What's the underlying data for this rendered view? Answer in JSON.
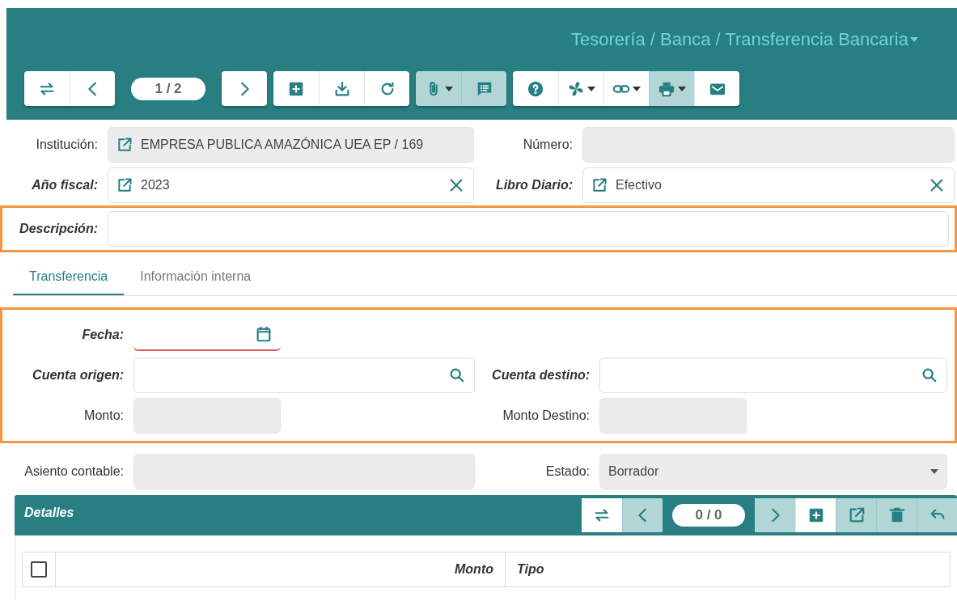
{
  "header": {
    "breadcrumb": "Tesorería / Banca / Transferencia Bancaria",
    "breadcrumb_dropdown": true
  },
  "toolbar": [
    {
      "kind": "group",
      "buttons": [
        {
          "kind": "swap",
          "disabled": false,
          "dropdown": false
        },
        {
          "kind": "prev",
          "disabled": false,
          "dropdown": false
        }
      ]
    },
    {
      "kind": "pager",
      "text": "1 / 2"
    },
    {
      "kind": "group",
      "buttons": [
        {
          "kind": "next",
          "disabled": false,
          "dropdown": false
        }
      ]
    },
    {
      "kind": "group",
      "buttons": [
        {
          "kind": "add",
          "disabled": false,
          "dropdown": false
        },
        {
          "kind": "download",
          "disabled": false,
          "dropdown": false
        },
        {
          "kind": "refresh",
          "disabled": false,
          "dropdown": false
        }
      ]
    },
    {
      "kind": "group",
      "buttons": [
        {
          "kind": "attach",
          "disabled": true,
          "dropdown": true
        },
        {
          "kind": "chat",
          "disabled": true,
          "dropdown": false
        }
      ]
    },
    {
      "kind": "group",
      "buttons": [
        {
          "kind": "help",
          "disabled": false,
          "dropdown": false
        },
        {
          "kind": "fan",
          "disabled": false,
          "dropdown": true
        },
        {
          "kind": "link",
          "disabled": false,
          "dropdown": true
        },
        {
          "kind": "print",
          "disabled": true,
          "dropdown": true
        },
        {
          "kind": "mail",
          "disabled": false,
          "dropdown": false
        }
      ]
    }
  ],
  "main_form": {
    "rows": [
      {
        "highlighted": false,
        "fields": [
          {
            "label": "Institución:",
            "required": false,
            "kind": "lookup",
            "readonly": true,
            "value": "EMPRESA PUBLICA AMAZÓNICA UEA EP / 169"
          },
          {
            "label": "Número:",
            "required": false,
            "kind": "text",
            "readonly": true
          }
        ]
      },
      {
        "highlighted": false,
        "fields": [
          {
            "label": "Año fiscal:",
            "required": true,
            "kind": "lookup",
            "readonly": false,
            "value": "2023"
          },
          {
            "label": "Libro Diario:",
            "required": true,
            "kind": "lookup",
            "readonly": false,
            "value": "Efectivo"
          }
        ]
      },
      {
        "highlighted": true,
        "fields": [
          {
            "label": "Descripción:",
            "required": true,
            "kind": "text",
            "readonly": false
          }
        ]
      }
    ]
  },
  "tabs": [
    {
      "label": "Transferencia",
      "selected": true
    },
    {
      "label": "Información interna",
      "selected": false
    }
  ],
  "transfer_section": {
    "highlighted": true,
    "rows": [
      {
        "fields": [
          {
            "label": "Fecha:",
            "required": true,
            "kind": "date",
            "readonly": false,
            "invalid": true
          }
        ]
      },
      {
        "fields": [
          {
            "label": "Cuenta origen:",
            "required": true,
            "kind": "search",
            "readonly": false
          },
          {
            "label": "Cuenta destino:",
            "required": true,
            "kind": "search",
            "readonly": false
          }
        ]
      },
      {
        "fields": [
          {
            "label": "Monto:",
            "required": false,
            "kind": "text",
            "readonly": true
          },
          {
            "label": "Monto Destino:",
            "required": false,
            "kind": "text",
            "readonly": true
          }
        ]
      }
    ]
  },
  "footer_row": {
    "fields": [
      {
        "label": "Asiento contable:",
        "required": false,
        "kind": "text",
        "readonly": true
      },
      {
        "label": "Estado:",
        "required": false,
        "kind": "select",
        "readonly": true,
        "value": "Borrador"
      }
    ]
  },
  "details": {
    "title": "Detalles",
    "toolbar": [
      {
        "kind": "group",
        "buttons": [
          {
            "kind": "swap",
            "disabled": false,
            "dropdown": false
          },
          {
            "kind": "prev",
            "disabled": true,
            "dropdown": false
          }
        ]
      },
      {
        "kind": "pager",
        "text": "0 / 0"
      },
      {
        "kind": "group",
        "buttons": [
          {
            "kind": "next",
            "disabled": true,
            "dropdown": false
          },
          {
            "kind": "add",
            "disabled": false,
            "dropdown": false
          },
          {
            "kind": "open",
            "disabled": true,
            "dropdown": false
          },
          {
            "kind": "delete",
            "disabled": true,
            "dropdown": false
          },
          {
            "kind": "undo",
            "disabled": true,
            "dropdown": false
          }
        ]
      }
    ],
    "select_all": {
      "checked": false
    },
    "columns": [
      {
        "label": "Monto"
      },
      {
        "label": "Tipo"
      }
    ]
  }
}
